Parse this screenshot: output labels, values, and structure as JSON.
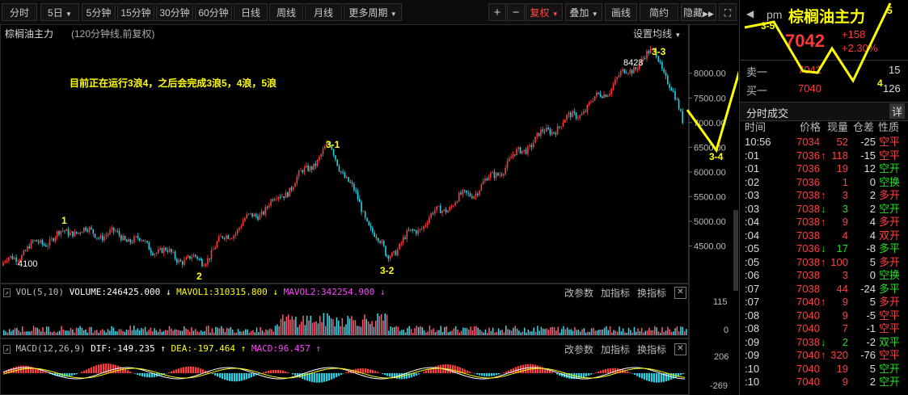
{
  "toolbar": {
    "items": [
      "分时",
      "5日",
      "5分钟",
      "15分钟",
      "30分钟",
      "60分钟",
      "日线",
      "周线",
      "月线",
      "更多周期"
    ],
    "right_items": [
      "复权",
      "叠加",
      "画线",
      "简约",
      "隐藏"
    ],
    "plus": "+",
    "minus": "−"
  },
  "chart": {
    "title": "棕榈油主力",
    "subtitle": "(120分钟线,前复权)",
    "settings": "设置均线",
    "annotation": "目前正在运行3浪4，之后会完成3浪5，4浪，5浪",
    "high_label": "8428",
    "low_label": "4100",
    "wave_labels": [
      "1",
      "2",
      "3-1",
      "3-2",
      "3-3",
      "3-4",
      "3-5",
      "4",
      "5"
    ],
    "price_ticks": [
      "8000.00",
      "7500.00",
      "7000.00",
      "6500.00",
      "6000.00",
      "5500.00",
      "5000.00",
      "4500.00"
    ],
    "vol": {
      "title": "VOL(5,10)",
      "volume": "VOLUME:246425.000",
      "mavol1": "MAVOL1:310315.800",
      "mavol2": "MAVOL2:342254.900",
      "ticks": [
        "115",
        "0"
      ]
    },
    "macd": {
      "title": "MACD(12,26,9)",
      "dif": "DIF:-149.235",
      "dea": "DEA:-197.464",
      "macd": "MACD:96.457",
      "ticks": [
        "206",
        "-269"
      ]
    },
    "panel_buttons": [
      "改参数",
      "加指标",
      "换指标"
    ]
  },
  "chart_data": {
    "type": "candlestick",
    "title": "棕榈油主力",
    "period": "120分钟线,前复权",
    "ylim": [
      4000,
      8700
    ],
    "key_points": [
      {
        "label": "start",
        "value": 4100
      },
      {
        "label": "1",
        "value": 4900
      },
      {
        "label": "2",
        "value": 4200
      },
      {
        "label": "3-1",
        "value": 6450
      },
      {
        "label": "3-2",
        "value": 4350
      },
      {
        "label": "3-3",
        "value": 8428
      },
      {
        "label": "current",
        "value": 7042
      }
    ]
  },
  "quote": {
    "time_tag": "pm",
    "name": "棕榈油主力",
    "price": "7042",
    "change": "+158",
    "pct": "+2.30%",
    "ask_label": "卖一",
    "ask_price": "7042",
    "ask_vol": "15",
    "bid_label": "买一",
    "bid_price": "7040",
    "bid_vol": "126",
    "ticks_title": "分时成交",
    "detail": "详",
    "cols": [
      "时间",
      "价格",
      "现量",
      "仓差",
      "性质"
    ]
  },
  "ticks": [
    {
      "t": "10:56",
      "p": "7034",
      "a": "",
      "v": "52",
      "d": "-25",
      "k": "空平",
      "pc": "#ff4040",
      "kc": "#ff4040"
    },
    {
      "t": ":01",
      "p": "7036",
      "a": "↑",
      "v": "118",
      "d": "-15",
      "k": "空平",
      "pc": "#ff4040",
      "kc": "#ff4040"
    },
    {
      "t": ":01",
      "p": "7036",
      "a": "",
      "v": "19",
      "d": "12",
      "k": "空开",
      "pc": "#ff4040",
      "kc": "#22dd22"
    },
    {
      "t": ":02",
      "p": "7036",
      "a": "",
      "v": "1",
      "d": "0",
      "k": "空换",
      "pc": "#ff4040",
      "kc": "#22dd22"
    },
    {
      "t": ":03",
      "p": "7038",
      "a": "↑",
      "v": "3",
      "d": "2",
      "k": "多开",
      "pc": "#ff4040",
      "kc": "#ff4040"
    },
    {
      "t": ":03",
      "p": "7038",
      "a": "↓",
      "v": "3",
      "d": "2",
      "k": "空开",
      "pc": "#ff4040",
      "kc": "#22dd22"
    },
    {
      "t": ":04",
      "p": "7038",
      "a": "↑",
      "v": "9",
      "d": "4",
      "k": "多开",
      "pc": "#ff4040",
      "kc": "#ff4040"
    },
    {
      "t": ":04",
      "p": "7038",
      "a": "",
      "v": "4",
      "d": "4",
      "k": "双开",
      "pc": "#ff4040",
      "kc": "#ff4040"
    },
    {
      "t": ":05",
      "p": "7036",
      "a": "↓",
      "v": "17",
      "d": "-8",
      "k": "多平",
      "pc": "#ff4040",
      "kc": "#22dd22"
    },
    {
      "t": ":05",
      "p": "7038",
      "a": "↑",
      "v": "100",
      "d": "5",
      "k": "多开",
      "pc": "#ff4040",
      "kc": "#ff4040"
    },
    {
      "t": ":06",
      "p": "7038",
      "a": "",
      "v": "3",
      "d": "0",
      "k": "空换",
      "pc": "#ff4040",
      "kc": "#22dd22"
    },
    {
      "t": ":07",
      "p": "7038",
      "a": "",
      "v": "44",
      "d": "-24",
      "k": "多平",
      "pc": "#ff4040",
      "kc": "#22dd22"
    },
    {
      "t": ":07",
      "p": "7040",
      "a": "↑",
      "v": "9",
      "d": "5",
      "k": "多开",
      "pc": "#ff4040",
      "kc": "#ff4040"
    },
    {
      "t": ":08",
      "p": "7040",
      "a": "",
      "v": "9",
      "d": "-5",
      "k": "空平",
      "pc": "#ff4040",
      "kc": "#ff4040"
    },
    {
      "t": ":08",
      "p": "7040",
      "a": "",
      "v": "7",
      "d": "-1",
      "k": "空平",
      "pc": "#ff4040",
      "kc": "#ff4040"
    },
    {
      "t": ":09",
      "p": "7038",
      "a": "↓",
      "v": "2",
      "d": "-2",
      "k": "双平",
      "pc": "#ff4040",
      "kc": "#22dd22"
    },
    {
      "t": ":09",
      "p": "7040",
      "a": "↑",
      "v": "320",
      "d": "-76",
      "k": "空平",
      "pc": "#ff4040",
      "kc": "#ff4040"
    },
    {
      "t": ":10",
      "p": "7040",
      "a": "",
      "v": "19",
      "d": "5",
      "k": "空开",
      "pc": "#ff4040",
      "kc": "#22dd22"
    },
    {
      "t": ":10",
      "p": "7040",
      "a": "",
      "v": "9",
      "d": "2",
      "k": "空开",
      "pc": "#ff4040",
      "kc": "#22dd22"
    }
  ]
}
